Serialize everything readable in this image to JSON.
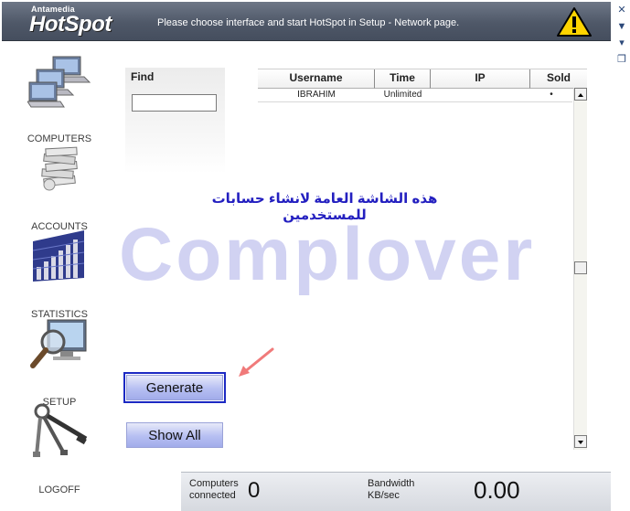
{
  "header": {
    "brand_small": "Antamedia",
    "brand_big": "HotSpot",
    "message": "Please choose interface and start HotSpot in Setup - Network page."
  },
  "nav": {
    "items": [
      {
        "label": "COMPUTERS",
        "icon": "computers-icon"
      },
      {
        "label": "ACCOUNTS",
        "icon": "accounts-icon"
      },
      {
        "label": "STATISTICS",
        "icon": "statistics-icon"
      },
      {
        "label": "SETUP",
        "icon": "setup-icon"
      },
      {
        "label": "LOGOFF",
        "icon": "logoff-icon"
      }
    ]
  },
  "find": {
    "label": "Find",
    "value": "",
    "placeholder": ""
  },
  "table": {
    "columns": [
      "Username",
      "Time",
      "IP",
      "Sold"
    ],
    "rows": [
      {
        "username": "IBRAHIM",
        "time": "Unlimited",
        "ip": "",
        "sold": "•"
      }
    ]
  },
  "overlay": {
    "arabic_caption": "هذه الشاشة العامة لانشاء حسابات للمستخدمين",
    "watermark": "Complover"
  },
  "buttons": {
    "generate": "Generate",
    "show_all": "Show All"
  },
  "status": {
    "computers_label_1": "Computers",
    "computers_label_2": "connected",
    "computers_value": "0",
    "bandwidth_label_1": "Bandwidth",
    "bandwidth_label_2": "KB/sec",
    "bandwidth_value": "0.00"
  },
  "colors": {
    "header_bg": "#4f5868",
    "button_bg": "#b6bff2",
    "focus_outline": "#1c29c3",
    "watermark": "#d1d2f2",
    "caption": "#2420c0",
    "warning": "#ffd400",
    "arrow": "#f07a7a"
  }
}
